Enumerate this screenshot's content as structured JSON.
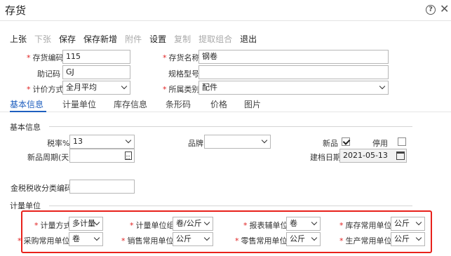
{
  "window": {
    "title": "存货"
  },
  "toolbar": {
    "items": [
      {
        "label": "上张",
        "enabled": true
      },
      {
        "label": "下张",
        "enabled": false
      },
      {
        "label": "保存",
        "enabled": true
      },
      {
        "label": "保存新增",
        "enabled": true
      },
      {
        "label": "附件",
        "enabled": false
      },
      {
        "label": "设置",
        "enabled": true
      },
      {
        "label": "复制",
        "enabled": false
      },
      {
        "label": "提取组合",
        "enabled": false
      },
      {
        "label": "退出",
        "enabled": true
      }
    ]
  },
  "header": {
    "code_label": "存货编码",
    "code_value": "115",
    "name_label": "存货名称",
    "name_value": "钢卷",
    "mnemonic_label": "助记码",
    "mnemonic_value": "GJ",
    "spec_label": "规格型号",
    "spec_value": "",
    "pricing_label": "计价方式",
    "pricing_value": "全月平均",
    "category_label": "所属类别",
    "category_value": "配件"
  },
  "tabs": [
    "基本信息",
    "计量单位",
    "库存信息",
    "条形码",
    "价格",
    "图片"
  ],
  "basic": {
    "section_title": "基本信息",
    "tax_label": "税率%",
    "tax_value": "13",
    "brand_label": "品牌",
    "brand_value": "",
    "new_label": "新品",
    "new_checked": true,
    "disabled_label": "停用",
    "disabled_checked": false,
    "new_period_label": "新品周期(天)",
    "new_period_value": "",
    "created_label": "建档日期",
    "created_value": "2021-05-13",
    "tax_class_label": "金税税收分类编码",
    "tax_class_value": ""
  },
  "units": {
    "section_title": "计量单位",
    "method_label": "计量方式",
    "method_value": "多计量",
    "group_label": "计量单位组",
    "group_value": "卷/公斤",
    "report_label": "报表辅单位",
    "report_value": "卷",
    "stock_label": "库存常用单位",
    "stock_value": "公斤",
    "purchase_label": "采购常用单位",
    "purchase_value": "卷",
    "sales_label": "销售常用单位",
    "sales_value": "公斤",
    "retail_label": "零售常用单位",
    "retail_value": "公斤",
    "production_label": "生产常用单位",
    "production_value": "公斤"
  },
  "colors": {
    "accent": "#1f5fbf",
    "required": "#e02020",
    "highlight": "#e8211b"
  },
  "icons": {
    "help": "help-icon",
    "close": "close-icon",
    "calendar": "calendar-icon",
    "calculator": "calculator-icon"
  }
}
